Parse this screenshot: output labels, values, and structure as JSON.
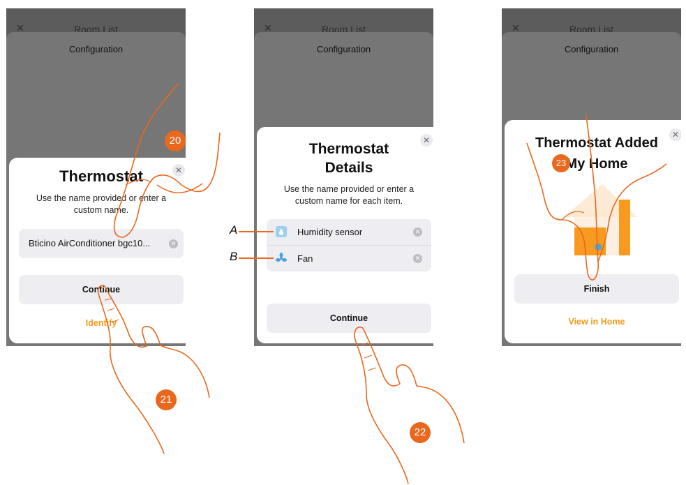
{
  "screens": [
    {
      "top_title": "Room List",
      "sheet_title": "Configuration",
      "dialog_title": "Thermostat",
      "dialog_subtitle": "Use the name provided or enter a custom name.",
      "name_field_value": "Bticino AirConditioner bgc10...",
      "continue_label": "Continue",
      "secondary_link": "Identify",
      "steps": [
        "20",
        "21"
      ]
    },
    {
      "top_title": "Room List",
      "sheet_title": "Configuration",
      "dialog_title_line1": "Thermostat",
      "dialog_title_line2": "Details",
      "dialog_subtitle": "Use the name provided or enter a custom name for each item.",
      "items": [
        {
          "callout": "A",
          "label": "Humidity sensor",
          "icon": "humidity-icon"
        },
        {
          "callout": "B",
          "label": "Fan",
          "icon": "fan-icon"
        }
      ],
      "continue_label": "Continue",
      "steps": [
        "22"
      ]
    },
    {
      "top_title": "Room List",
      "sheet_title": "Configuration",
      "dialog_title_line1": "Thermostat Added",
      "dialog_title_line2": "My Home",
      "finish_label": "Finish",
      "view_link": "View in Home",
      "steps": [
        "23"
      ]
    }
  ],
  "colors": {
    "accent": "#f39a1c",
    "step_badge": "#e8681e",
    "hand_line": "#e8681e",
    "overlay": "#767676"
  }
}
